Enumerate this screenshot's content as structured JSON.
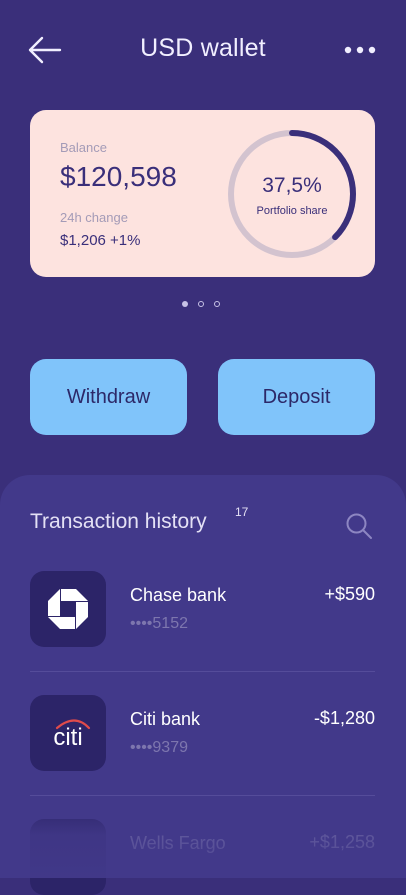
{
  "header": {
    "title": "USD wallet"
  },
  "icons": {
    "back": "arrow-left-icon",
    "more": "more-horizontal-icon",
    "search": "search-icon"
  },
  "colors": {
    "background": "#3a2f7a",
    "card": "#fde3df",
    "button": "#80c4fa",
    "panel": "#42398a",
    "accent": "#3a2f7a"
  },
  "balance_card": {
    "balance_label": "Balance",
    "balance_value": "$120,598",
    "change_label": "24h change",
    "change_value": "$1,206 +1%",
    "share_value": "37,5%",
    "share_label": "Portfolio share",
    "share_fraction": 0.375
  },
  "pager": {
    "count": 3,
    "active_index": 0
  },
  "actions": {
    "withdraw_label": "Withdraw",
    "deposit_label": "Deposit"
  },
  "history": {
    "title": "Transaction history",
    "count": "17",
    "transactions": [
      {
        "name": "Chase bank",
        "account": "••••5152",
        "amount": "+$590",
        "logo": "chase-logo"
      },
      {
        "name": "Citi bank",
        "account": "••••9379",
        "amount": "-$1,280",
        "logo_text": "citi",
        "logo": "citi-logo"
      },
      {
        "name": "Wells Fargo",
        "amount": "+$1,258",
        "logo": "wells-fargo-logo"
      }
    ]
  }
}
